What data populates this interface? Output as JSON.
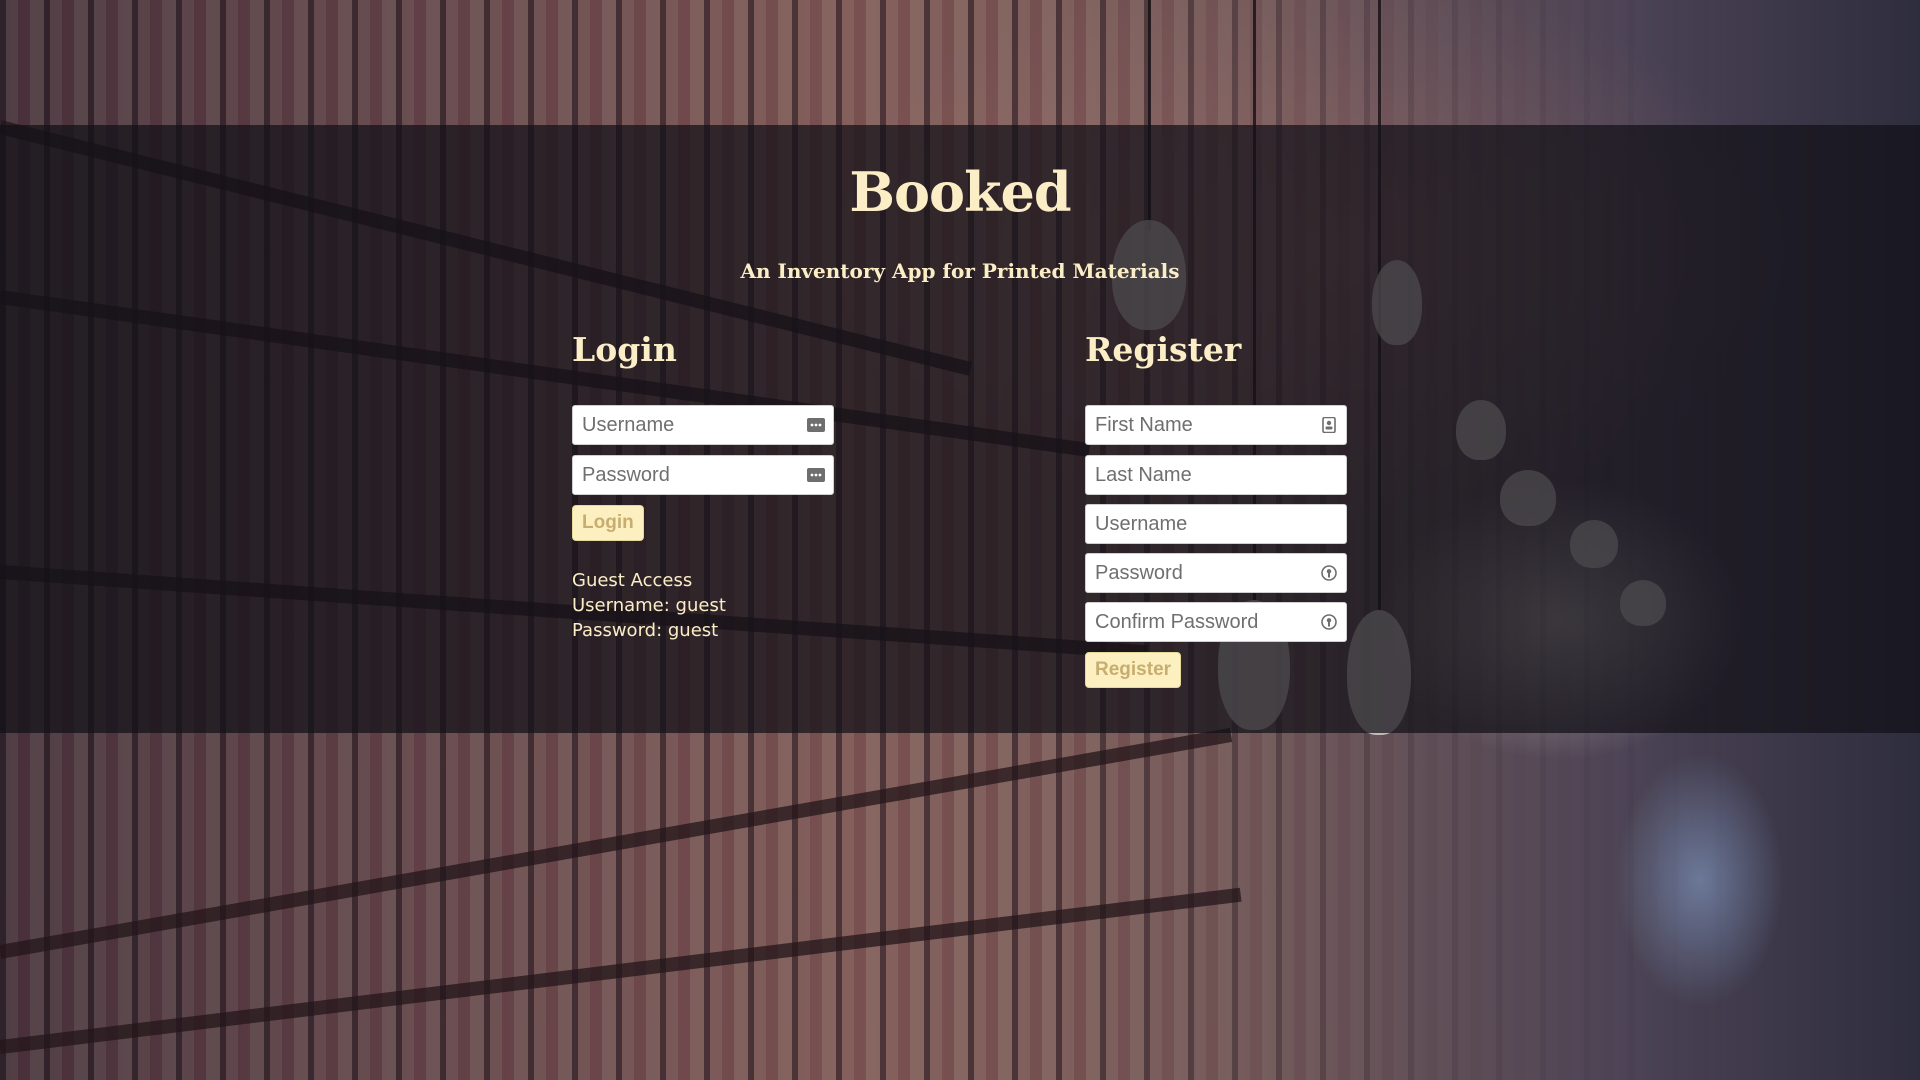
{
  "app": {
    "title": "Booked",
    "subtitle": "An Inventory App for Printed Materials"
  },
  "login": {
    "heading": "Login",
    "username_placeholder": "Username",
    "password_placeholder": "Password",
    "button_label": "Login",
    "username_icon": "dots-keyboard-icon",
    "password_icon": "dots-keyboard-icon"
  },
  "guest_access": {
    "title": "Guest Access",
    "username_line": "Username: guest",
    "password_line": "Password: guest"
  },
  "register": {
    "heading": "Register",
    "first_name_placeholder": "First Name",
    "last_name_placeholder": "Last Name",
    "username_placeholder": "Username",
    "password_placeholder": "Password",
    "confirm_password_placeholder": "Confirm Password",
    "button_label": "Register",
    "first_name_icon": "contact-card-icon",
    "password_icon": "key-lock-icon",
    "confirm_password_icon": "key-lock-icon"
  },
  "colors": {
    "accent_text": "#fbeec6",
    "button_bg": "#fcf0c0",
    "button_text": "#c8ad70",
    "band_overlay": "rgba(18,16,24,0.72)"
  }
}
